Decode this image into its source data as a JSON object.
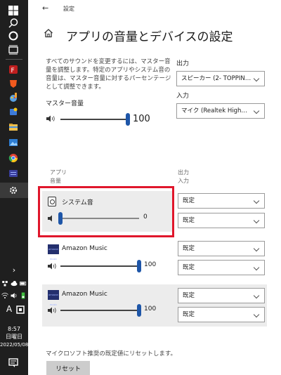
{
  "window": {
    "back_arrow": "←",
    "title": "設定"
  },
  "page": {
    "title": "アプリの音量とデバイスの設定",
    "description": "すべてのサウンドを変更するには、マスター音量を調整します。特定のアプリやシステム音の音量は、マスター音量に対するパーセンテージとして調整できます。",
    "master_label": "マスター音量",
    "master_volume": "100",
    "master_volume_level": 1.0
  },
  "output": {
    "label": "出力",
    "value": "スピーカー (2- TOPPIN…"
  },
  "input": {
    "label": "入力",
    "value": "マイク (Realtek High…"
  },
  "columns": {
    "app": "アプリ",
    "volume": "音量",
    "output": "出力",
    "input": "入力"
  },
  "apps": [
    {
      "name": "システム音",
      "volume": "0",
      "level": 0.0,
      "output": "既定",
      "input": "既定",
      "icon": "speaker-icon"
    },
    {
      "name": "Amazon Music",
      "volume": "100",
      "level": 1.0,
      "output": "既定",
      "input": "既定",
      "icon": "amazon-music-icon",
      "icon_text": "amazon music"
    },
    {
      "name": "Amazon Music",
      "volume": "100",
      "level": 1.0,
      "output": "既定",
      "input": "既定",
      "icon": "amazon-music-icon",
      "icon_text": "amazon music"
    }
  ],
  "reset": {
    "text": "マイクロソフト推奨の既定値にリセットします。",
    "button": "リセット"
  },
  "taskbar": {
    "time": "8:57",
    "day": "日曜日",
    "date": "2022/05/08",
    "ime": "A",
    "chevron": "›"
  },
  "colors": {
    "accent": "#1e56a8",
    "highlight": "#e0162b",
    "taskbar": "#1f1f1f",
    "panel": "#ececec"
  }
}
